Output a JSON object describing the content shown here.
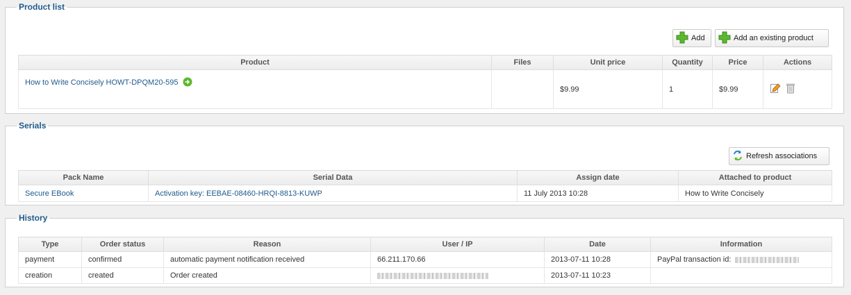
{
  "product_list": {
    "legend": "Product list",
    "add_label": "Add",
    "add_existing_label": "Add an existing product",
    "headers": [
      "Product",
      "Files",
      "Unit price",
      "Quantity",
      "Price",
      "Actions"
    ],
    "rows": [
      {
        "product": "How to Write Concisely HOWT-DPQM20-595",
        "files": "",
        "unit_price": "$9.99",
        "quantity": "1",
        "price": "$9.99"
      }
    ]
  },
  "serials": {
    "legend": "Serials",
    "refresh_label": "Refresh associations",
    "headers": [
      "Pack Name",
      "Serial Data",
      "Assign date",
      "Attached to product"
    ],
    "rows": [
      {
        "pack_name": "Secure EBook",
        "serial_data": "Activation key: EEBAE-08460-HRQI-8813-KUWP",
        "assign_date": "11 July 2013 10:28",
        "attached": "How to Write Concisely"
      }
    ]
  },
  "history": {
    "legend": "History",
    "headers": [
      "Type",
      "Order status",
      "Reason",
      "User / IP",
      "Date",
      "Information"
    ],
    "rows": [
      {
        "type": "payment",
        "status": "confirmed",
        "reason": "automatic payment notification received",
        "user_ip": "66.211.170.66",
        "date": "2013-07-11 10:28",
        "information": "PayPal transaction id:"
      },
      {
        "type": "creation",
        "status": "created",
        "reason": "Order created",
        "user_ip": "",
        "date": "2013-07-11 10:23",
        "information": ""
      }
    ]
  },
  "colors": {
    "legend": "#1f5a8c",
    "link": "#1f5a8c",
    "add_icon": "#5cb82e"
  }
}
